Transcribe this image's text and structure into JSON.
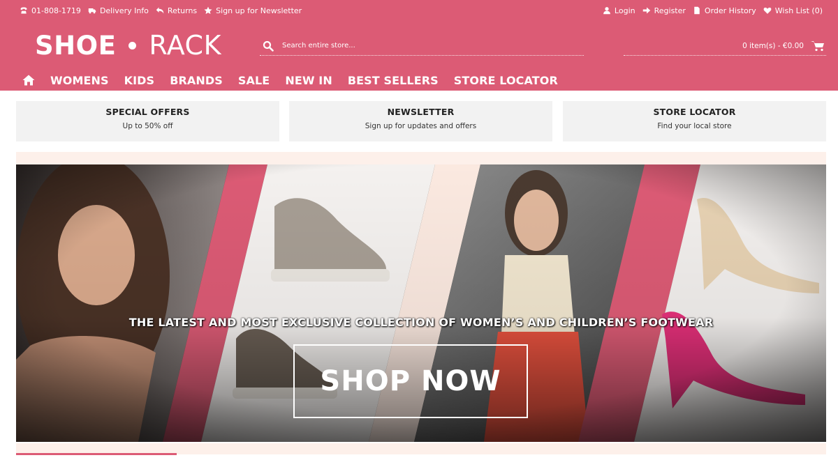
{
  "topbar": {
    "phone": "01-808-1719",
    "delivery": "Delivery Info",
    "returns": "Returns",
    "newsletter": "Sign up for Newsletter",
    "login": "Login",
    "register": "Register",
    "order_history": "Order History",
    "wishlist": "Wish List (0)"
  },
  "logo": {
    "word1": "SHOE",
    "word2": "RACK"
  },
  "search": {
    "placeholder": "Search entire store..."
  },
  "cart": {
    "label": "0 item(s) - €0.00"
  },
  "nav": {
    "items": [
      "WOMENS",
      "KIDS",
      "BRANDS",
      "SALE",
      "NEW IN",
      "BEST SELLERS",
      "STORE LOCATOR"
    ]
  },
  "promos": [
    {
      "title": "SPECIAL OFFERS",
      "subtitle": "Up to 50% off"
    },
    {
      "title": "NEWSLETTER",
      "subtitle": "Sign up for updates and offers"
    },
    {
      "title": "STORE LOCATOR",
      "subtitle": "Find your local store"
    }
  ],
  "hero": {
    "tagline": "THE LATEST AND MOST EXCLUSIVE COLLECTION OF WOMEN’S AND CHILDREN’S FOOTWEAR",
    "button": "SHOP NOW"
  },
  "colors": {
    "brand_pink": "#dc5b75",
    "peach": "#fdf0ea",
    "promo_bg": "#f2f2f2"
  },
  "icons": [
    "phone-icon",
    "truck-icon",
    "returns-icon",
    "star-icon",
    "user-icon",
    "register-icon",
    "document-icon",
    "heart-icon",
    "search-icon",
    "cart-icon",
    "home-icon"
  ]
}
